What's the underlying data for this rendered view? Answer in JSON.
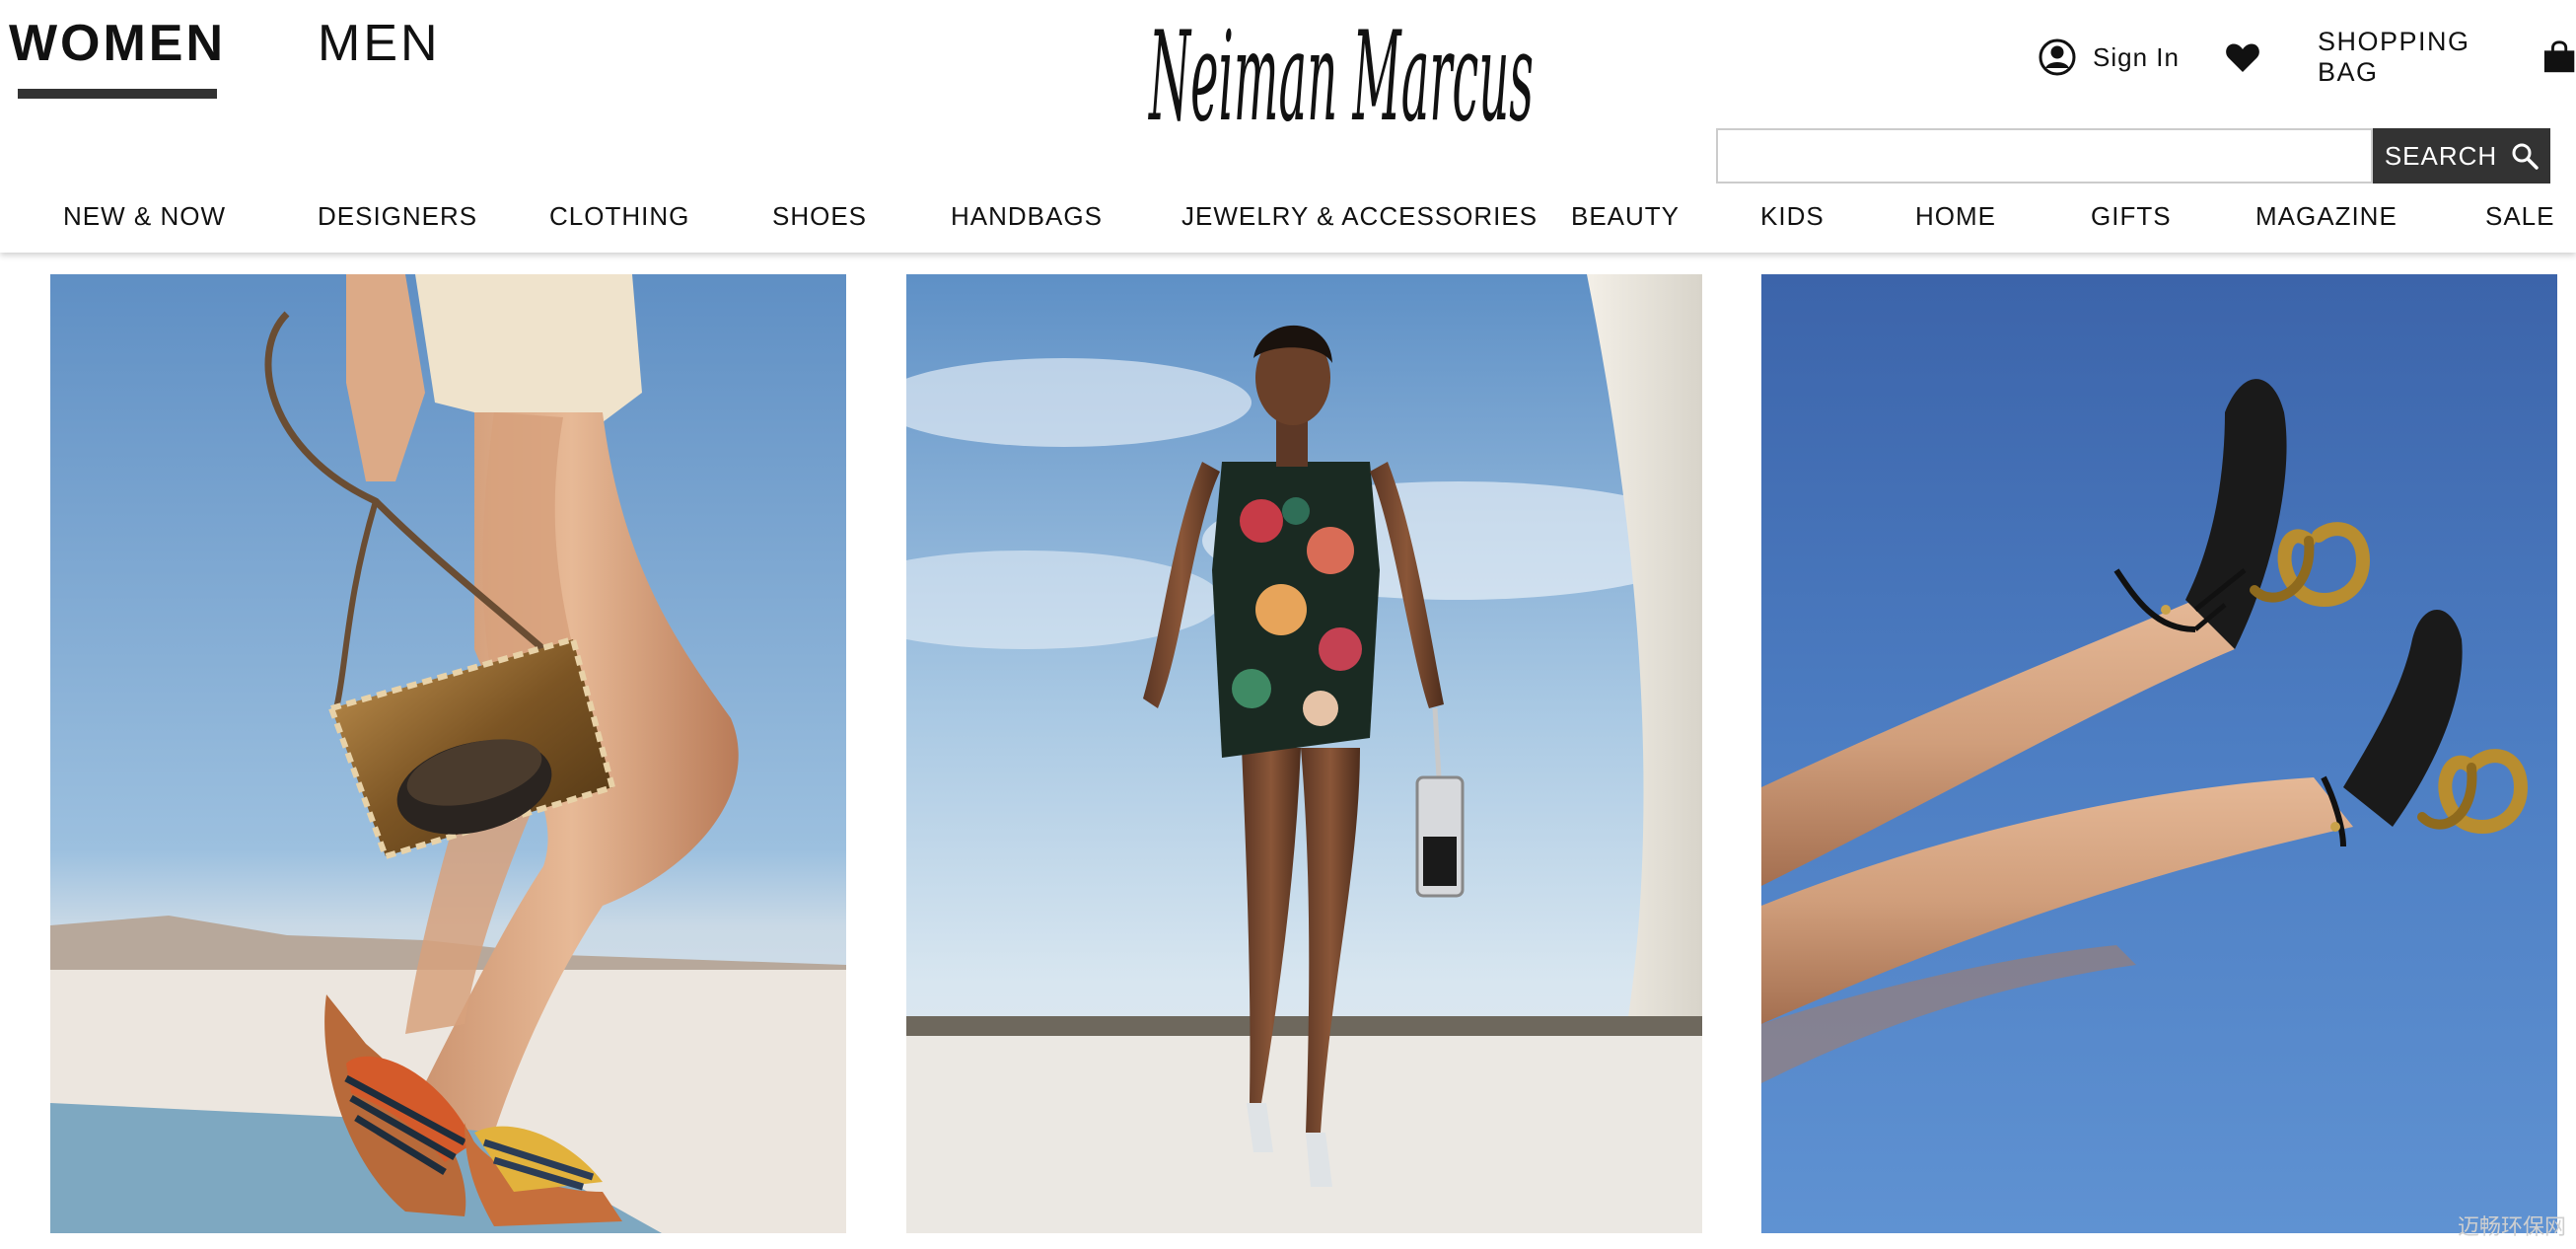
{
  "gender_tabs": [
    {
      "label": "WOMEN",
      "selected": true
    },
    {
      "label": "MEN",
      "selected": false
    }
  ],
  "brand": {
    "logo_text": "Neiman Marcus"
  },
  "utility": {
    "sign_in": {
      "label": "Sign In",
      "icon": "user-circle-icon"
    },
    "wishlist": {
      "icon": "heart-icon"
    },
    "bag": {
      "label": "SHOPPING BAG",
      "icon": "shopping-bag-icon"
    }
  },
  "search": {
    "placeholder": "",
    "value": "",
    "button_label": "SEARCH",
    "icon": "search-icon"
  },
  "nav": {
    "items": [
      {
        "label": "NEW & NOW"
      },
      {
        "label": "DESIGNERS"
      },
      {
        "label": "CLOTHING"
      },
      {
        "label": "SHOES"
      },
      {
        "label": "HANDBAGS"
      },
      {
        "label": "JEWELRY & ACCESSORIES"
      },
      {
        "label": "BEAUTY"
      },
      {
        "label": "KIDS"
      },
      {
        "label": "HOME"
      },
      {
        "label": "GIFTS"
      },
      {
        "label": "MAGAZINE"
      },
      {
        "label": "SALE"
      }
    ]
  },
  "hero_tiles": [
    {
      "subject": "model with bronze crossbody handbag and woven slide sandals"
    },
    {
      "subject": "model in floral slip dress carrying crystal mini bag"
    },
    {
      "subject": "legs in black ankle-strap heels with sculpted gold heels"
    }
  ],
  "watermark": {
    "text": "迈畅环保网"
  },
  "colors": {
    "nav_accent": "#333333",
    "search_button": "#333333",
    "sky_blue": "#6f9ccc"
  }
}
